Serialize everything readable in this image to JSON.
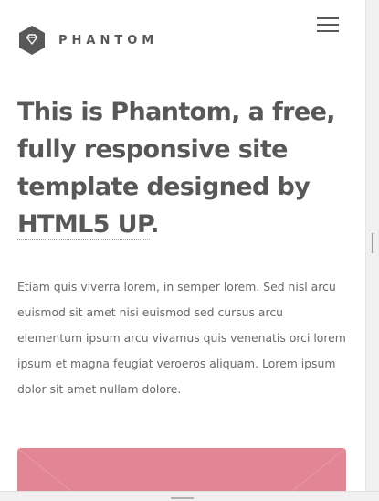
{
  "header": {
    "logo_icon": "diamond-icon",
    "logo_text": "PHANTOM",
    "menu_icon": "hamburger-menu-icon"
  },
  "intro": {
    "headline_text": "This is Phantom, a free, fully responsive site template designed by ",
    "headline_link": "HTML5 UP",
    "headline_end": ".",
    "paragraph": "Etiam quis viverra lorem, in semper lorem. Sed nisl arcu euismod sit amet nisi euismod sed cursus arcu elementum ipsum arcu vivamus quis venenatis orci lorem ipsum et magna feugiat veroeros aliquam. Lorem ipsum dolor sit amet nullam dolore."
  },
  "colors": {
    "text": "#585858",
    "tile_pink": "#e28594"
  }
}
